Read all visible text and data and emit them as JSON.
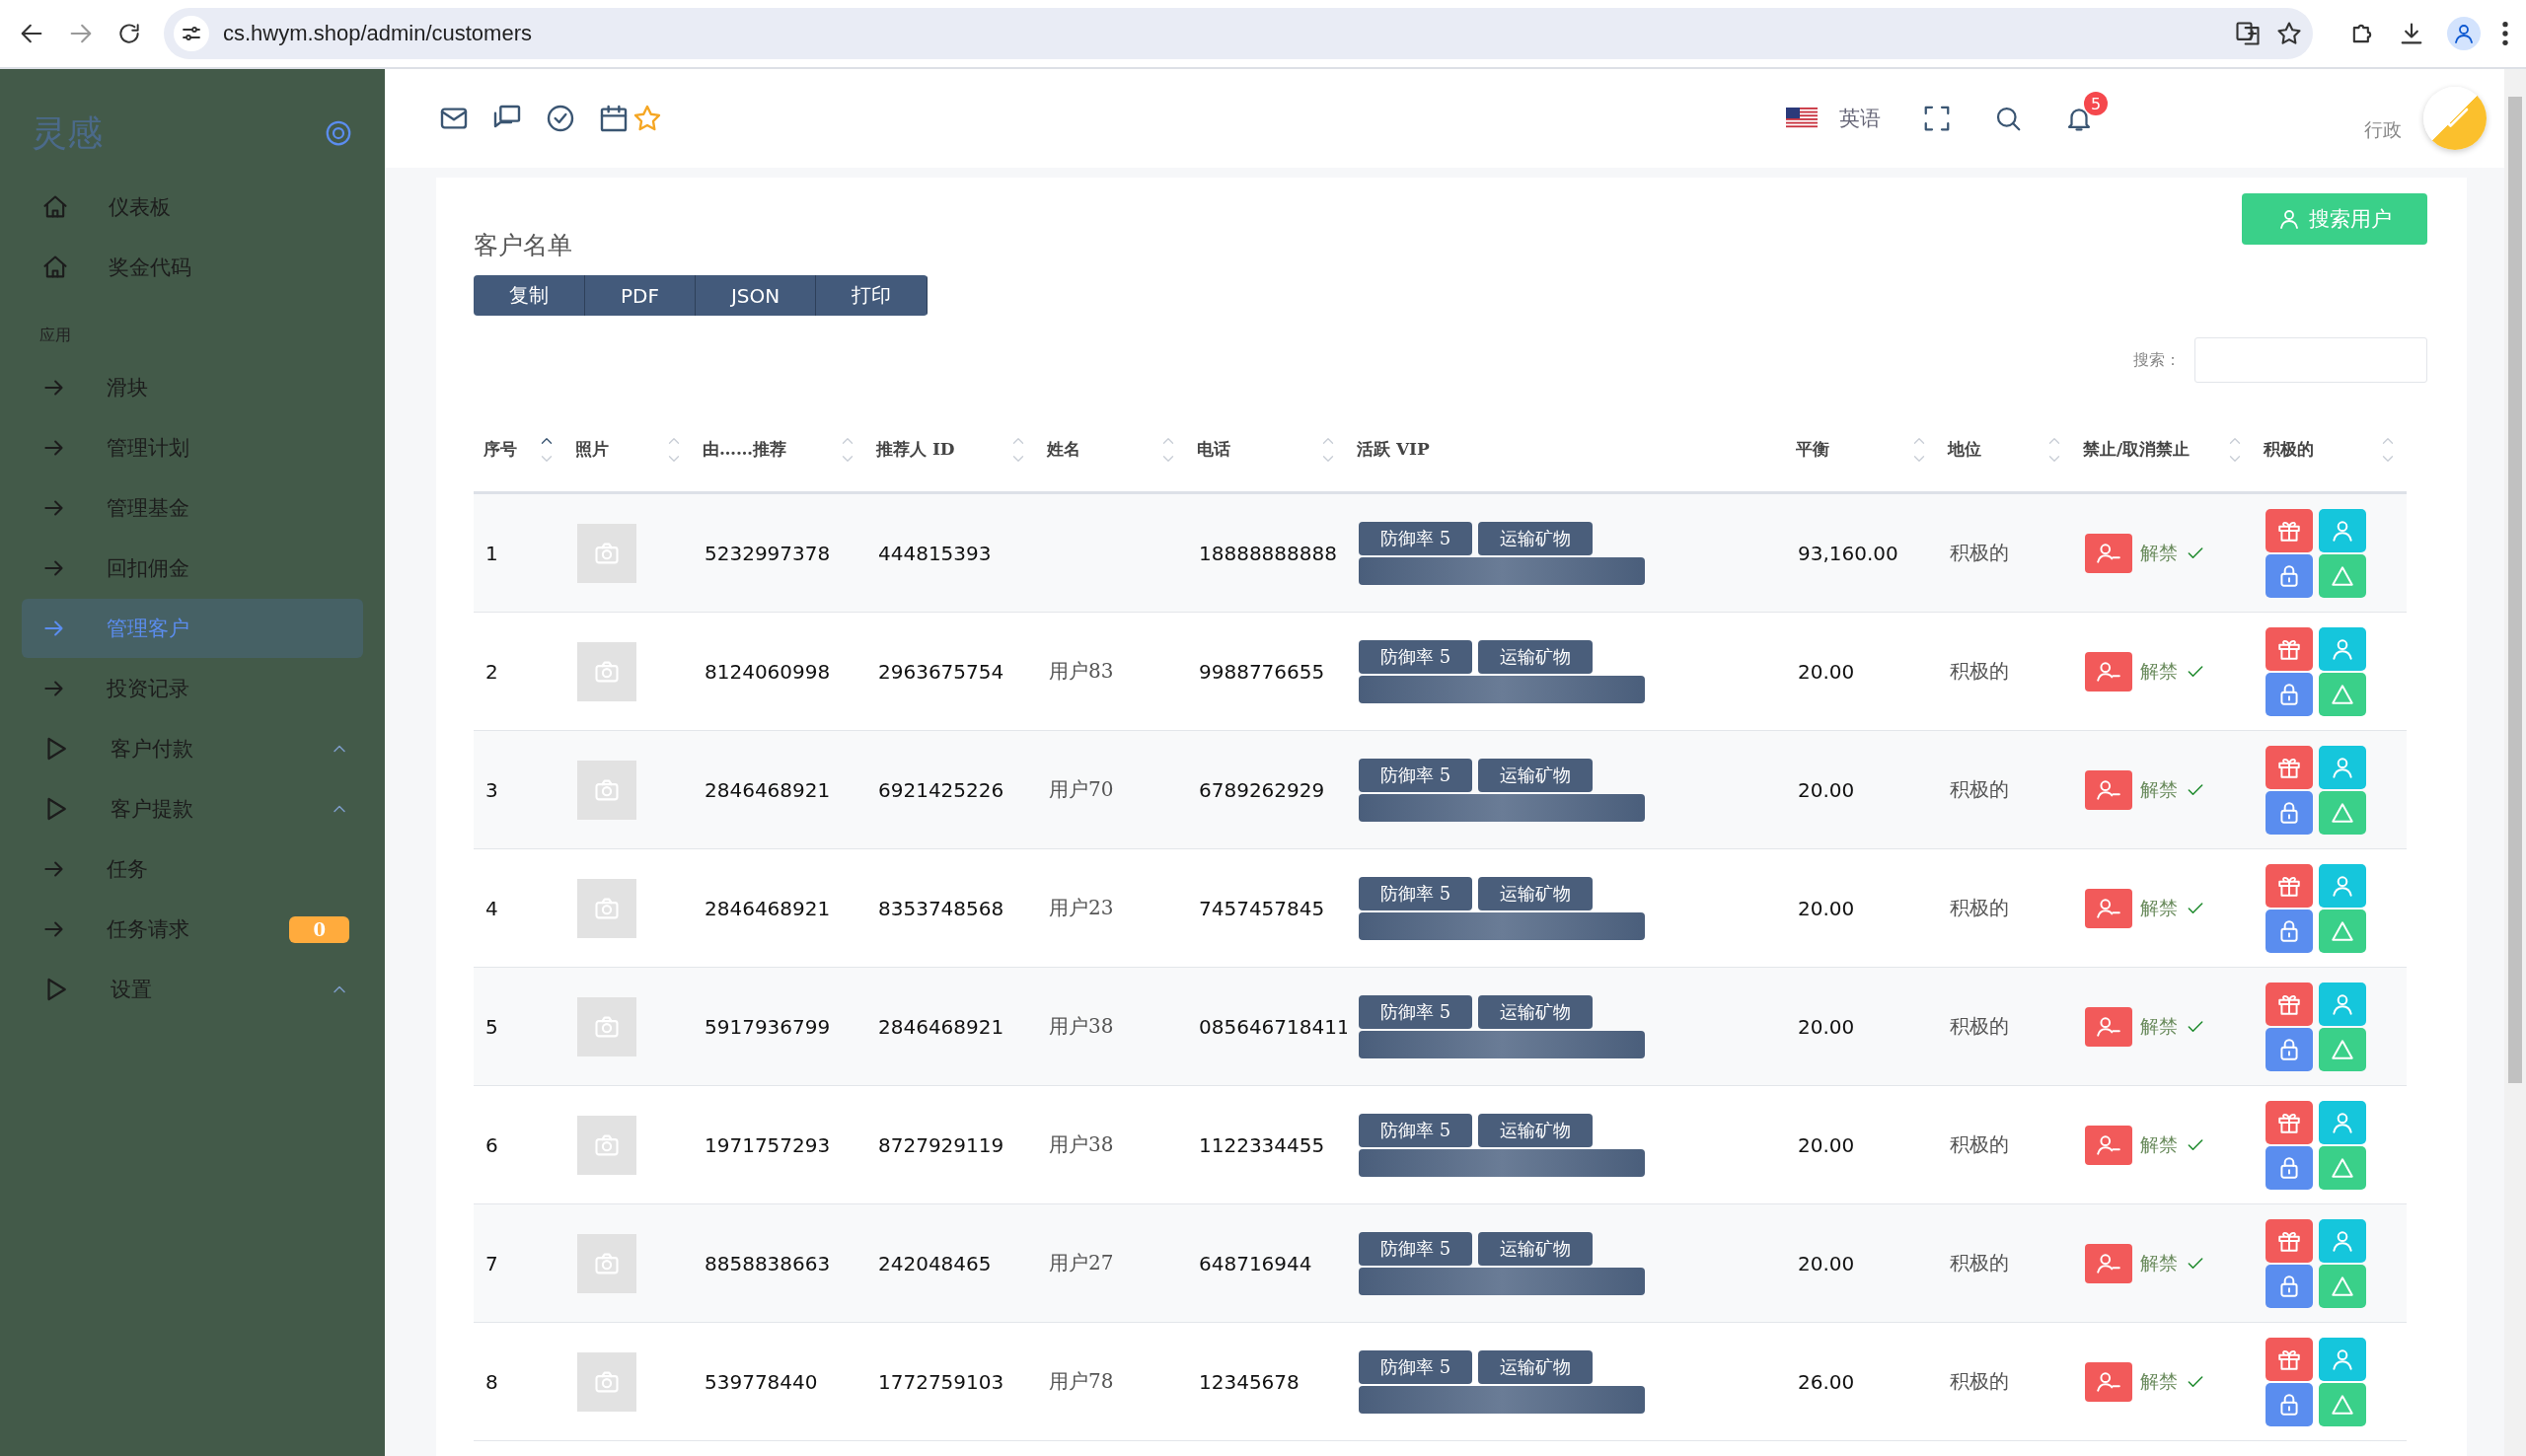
{
  "browser": {
    "url": "cs.hwym.shop/admin/customers"
  },
  "sidebar": {
    "logo": "灵感",
    "items": [
      {
        "label": "仪表板",
        "kind": "home",
        "selected": false
      },
      {
        "label": "奖金代码",
        "kind": "home",
        "selected": false
      },
      {
        "label": "应用",
        "kind": "section"
      },
      {
        "label": "滑块",
        "kind": "link",
        "selected": false
      },
      {
        "label": "管理计划",
        "kind": "link",
        "selected": false
      },
      {
        "label": "管理基金",
        "kind": "link",
        "selected": false
      },
      {
        "label": "回扣佣金",
        "kind": "link",
        "selected": false
      },
      {
        "label": "管理客户",
        "kind": "link",
        "selected": true
      },
      {
        "label": "投资记录",
        "kind": "link",
        "selected": false
      },
      {
        "label": "客户付款",
        "kind": "group",
        "selected": false
      },
      {
        "label": "客户提款",
        "kind": "group",
        "selected": false
      },
      {
        "label": "任务",
        "kind": "link",
        "selected": false
      },
      {
        "label": "任务请求",
        "kind": "link",
        "selected": false,
        "badge": "0"
      },
      {
        "label": "设置",
        "kind": "group",
        "selected": false
      }
    ]
  },
  "header": {
    "language": "英语",
    "notifications": "5",
    "role": "行政"
  },
  "page": {
    "title": "客户名单",
    "search_button": "搜索用户",
    "export_buttons": [
      "复制",
      "PDF",
      "JSON",
      "打印"
    ],
    "search_label": "搜索："
  },
  "table": {
    "columns": [
      {
        "label": "序号",
        "sortable": true,
        "sorted": true
      },
      {
        "label": "照片",
        "sortable": true,
        "sorted": false
      },
      {
        "label": "由……推荐",
        "sortable": true,
        "sorted": false
      },
      {
        "label": "推荐人 ID",
        "sortable": true,
        "sorted": false
      },
      {
        "label": "姓名",
        "sortable": true,
        "sorted": false
      },
      {
        "label": "电话",
        "sortable": true,
        "sorted": false
      },
      {
        "label": "活跃 VIP",
        "sortable": false
      },
      {
        "label": "平衡",
        "sortable": true,
        "sorted": false
      },
      {
        "label": "地位",
        "sortable": true,
        "sorted": false
      },
      {
        "label": "禁止/取消禁止",
        "sortable": true,
        "sorted": false
      },
      {
        "label": "积极的",
        "sortable": true,
        "sorted": false
      }
    ],
    "rows": [
      {
        "no": "1",
        "referred_by": "5232997378",
        "referrer_id": "444815393",
        "phone": "18888888888",
        "vip": [
          "防御率 5",
          "运输矿物"
        ],
        "balance": "93,160.00",
        "status": "积极的",
        "ban": "解禁"
      },
      {
        "no": "2",
        "referred_by": "8124060998",
        "referrer_id": "2963675754",
        "name": "用户83",
        "phone": "9988776655",
        "vip": [
          "防御率 5",
          "运输矿物"
        ],
        "balance": "20.00",
        "status": "积极的",
        "ban": "解禁"
      },
      {
        "no": "3",
        "referred_by": "2846468921",
        "referrer_id": "6921425226",
        "name": "用户70",
        "phone": "6789262929",
        "vip": [
          "防御率 5",
          "运输矿物"
        ],
        "balance": "20.00",
        "status": "积极的",
        "ban": "解禁"
      },
      {
        "no": "4",
        "referred_by": "2846468921",
        "referrer_id": "8353748568",
        "name": "用户23",
        "phone": "7457457845",
        "vip": [
          "防御率 5",
          "运输矿物"
        ],
        "balance": "20.00",
        "status": "积极的",
        "ban": "解禁"
      },
      {
        "no": "5",
        "referred_by": "5917936799",
        "referrer_id": "2846468921",
        "name": "用户38",
        "phone": "085646718411",
        "vip": [
          "防御率 5",
          "运输矿物"
        ],
        "balance": "20.00",
        "status": "积极的",
        "ban": "解禁"
      },
      {
        "no": "6",
        "referred_by": "1971757293",
        "referrer_id": "8727929119",
        "name": "用户38",
        "phone": "1122334455",
        "vip": [
          "防御率 5",
          "运输矿物"
        ],
        "balance": "20.00",
        "status": "积极的",
        "ban": "解禁"
      },
      {
        "no": "7",
        "referred_by": "8858838663",
        "referrer_id": "242048465",
        "name": "用户27",
        "phone": "648716944",
        "vip": [
          "防御率 5",
          "运输矿物"
        ],
        "balance": "20.00",
        "status": "积极的",
        "ban": "解禁"
      },
      {
        "no": "8",
        "referred_by": "539778440",
        "referrer_id": "1772759103",
        "name": "用户78",
        "phone": "12345678",
        "vip": [
          "防御率 5",
          "运输矿物"
        ],
        "balance": "26.00",
        "status": "积极的",
        "ban": "解禁"
      }
    ]
  }
}
